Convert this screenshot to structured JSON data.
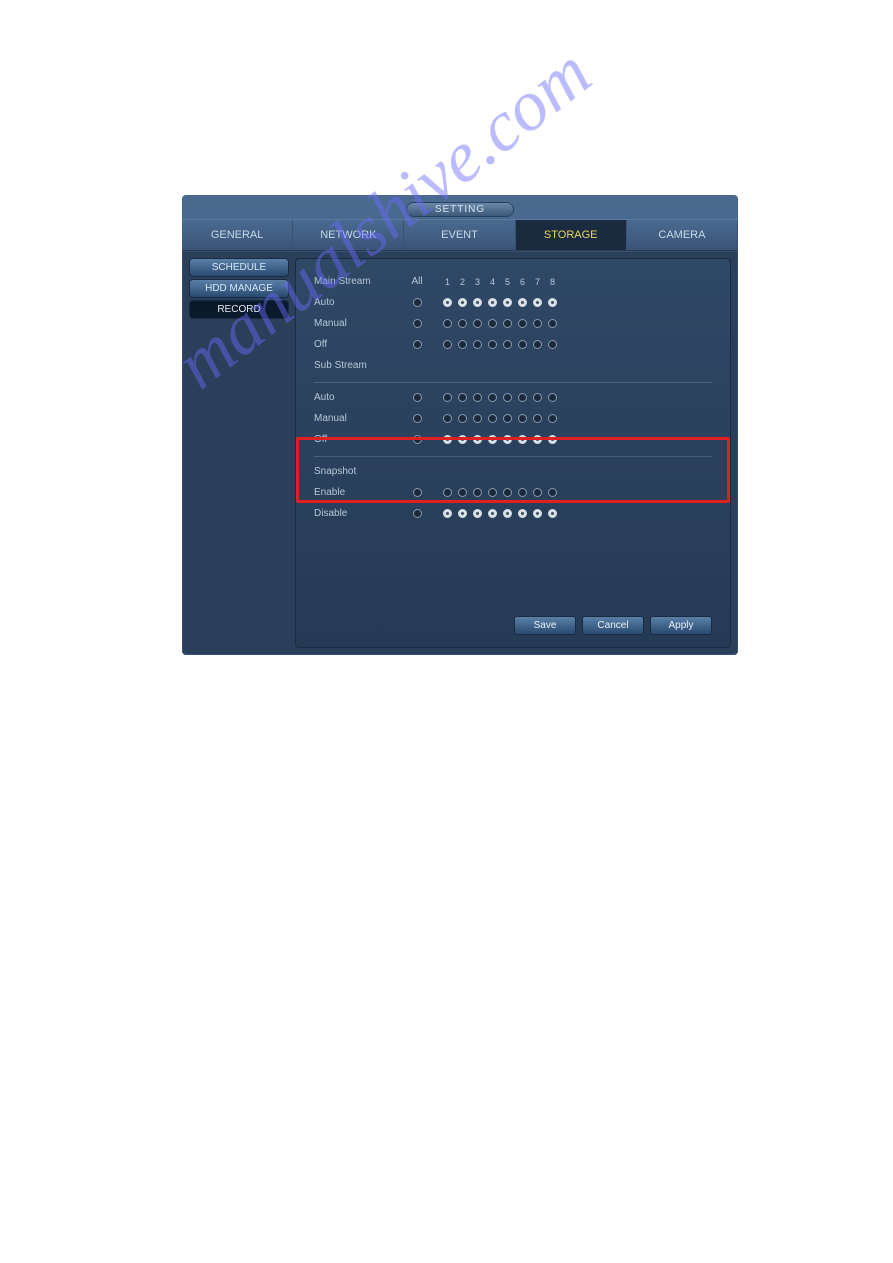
{
  "title": "SETTING",
  "tabs": [
    {
      "label": "GENERAL",
      "active": false
    },
    {
      "label": "NETWORK",
      "active": false
    },
    {
      "label": "EVENT",
      "active": false
    },
    {
      "label": "STORAGE",
      "active": true
    },
    {
      "label": "CAMERA",
      "active": false
    }
  ],
  "sidebar": [
    {
      "label": "SCHEDULE",
      "active": false
    },
    {
      "label": "HDD MANAGE",
      "active": false
    },
    {
      "label": "RECORD",
      "active": true
    }
  ],
  "header": {
    "section": "Main Stream",
    "all": "All",
    "cols": [
      "1",
      "2",
      "3",
      "4",
      "5",
      "6",
      "7",
      "8"
    ]
  },
  "sections": {
    "main_stream": {
      "label": "Main Stream",
      "rows": [
        {
          "name": "Auto",
          "all": false,
          "ch": [
            true,
            true,
            true,
            true,
            true,
            true,
            true,
            true
          ]
        },
        {
          "name": "Manual",
          "all": false,
          "ch": [
            false,
            false,
            false,
            false,
            false,
            false,
            false,
            false
          ]
        },
        {
          "name": "Off",
          "all": false,
          "ch": [
            false,
            false,
            false,
            false,
            false,
            false,
            false,
            false
          ]
        }
      ]
    },
    "sub_stream": {
      "label": "Sub Stream",
      "rows": [
        {
          "name": "Auto",
          "all": false,
          "ch": [
            false,
            false,
            false,
            false,
            false,
            false,
            false,
            false
          ]
        },
        {
          "name": "Manual",
          "all": false,
          "ch": [
            false,
            false,
            false,
            false,
            false,
            false,
            false,
            false
          ]
        },
        {
          "name": "Off",
          "all": false,
          "ch": [
            true,
            true,
            true,
            true,
            true,
            true,
            true,
            true
          ]
        }
      ]
    },
    "snapshot": {
      "label": "Snapshot",
      "rows": [
        {
          "name": "Enable",
          "all": false,
          "ch": [
            false,
            false,
            false,
            false,
            false,
            false,
            false,
            false
          ]
        },
        {
          "name": "Disable",
          "all": false,
          "ch": [
            true,
            true,
            true,
            true,
            true,
            true,
            true,
            true
          ]
        }
      ]
    }
  },
  "buttons": {
    "save": "Save",
    "cancel": "Cancel",
    "apply": "Apply"
  },
  "watermark": "manualshive.com"
}
